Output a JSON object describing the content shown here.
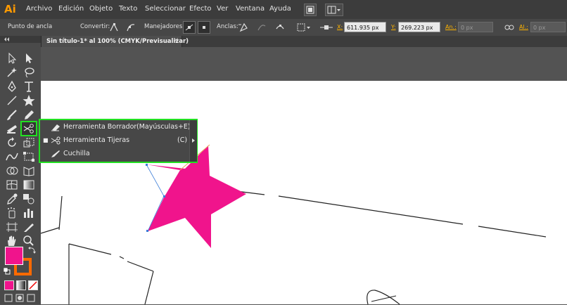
{
  "app": {
    "logo_text": "Ai",
    "brand_color": "#ff9a00"
  },
  "menubar": {
    "items": [
      "Archivo",
      "Edición",
      "Objeto",
      "Texto",
      "Seleccionar",
      "Efecto",
      "Ver",
      "Ventana",
      "Ayuda"
    ]
  },
  "control_bar": {
    "mode_label": "Punto de ancla",
    "convert_label": "Convertir:",
    "handles_label": "Manejadores:",
    "anchors_label": "Anclas:",
    "x_key": "X:",
    "x_value": "611.935 px",
    "y_key": "Y:",
    "y_value": "269.223 px",
    "w_key": "An.:",
    "w_value": "0 px",
    "h_key": "Al.:",
    "h_value": "0 px"
  },
  "document": {
    "tab_title": "Sin título-1* al 100% (CMYK/Previsualizar)",
    "close_glyph": "×"
  },
  "flyout": {
    "items": [
      {
        "icon": "eraser-icon",
        "label": "Herramienta Borrador",
        "shortcut": "(Mayúsculas+E)",
        "selected": false
      },
      {
        "icon": "scissors-icon",
        "label": "Herramienta Tijeras",
        "shortcut": "(C)",
        "selected": true
      },
      {
        "icon": "knife-icon",
        "label": "Cuchilla",
        "shortcut": "",
        "selected": false
      }
    ],
    "highlight_color": "#22e022"
  },
  "swatches": {
    "fill_color": "#f0148c",
    "stroke_color": "#ff6a00"
  },
  "artwork": {
    "shape_color": "#f0148c"
  }
}
